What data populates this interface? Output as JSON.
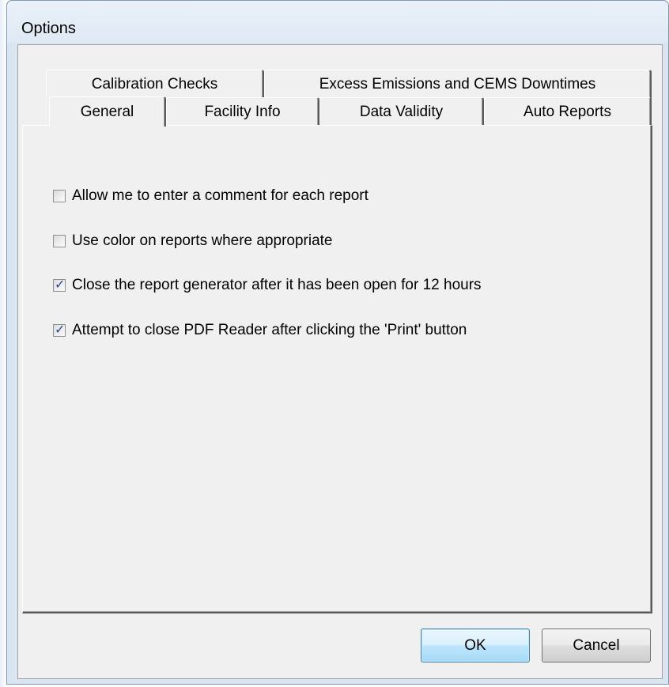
{
  "window": {
    "title": "Options"
  },
  "tabs": {
    "row_back": [
      {
        "label": "Calibration Checks"
      },
      {
        "label": "Excess Emissions and CEMS Downtimes"
      }
    ],
    "row_front": [
      {
        "label": "General",
        "active": true
      },
      {
        "label": "Facility Info"
      },
      {
        "label": "Data Validity"
      },
      {
        "label": "Auto Reports"
      }
    ]
  },
  "general": {
    "options": [
      {
        "label": "Allow me to enter a comment for each report",
        "checked": false
      },
      {
        "label": "Use color on reports where appropriate",
        "checked": false
      },
      {
        "label": "Close the report generator after it has been open for 12 hours",
        "checked": true
      },
      {
        "label": "Attempt to close PDF Reader after clicking the 'Print' button",
        "checked": true
      }
    ]
  },
  "buttons": {
    "ok": "OK",
    "cancel": "Cancel"
  }
}
